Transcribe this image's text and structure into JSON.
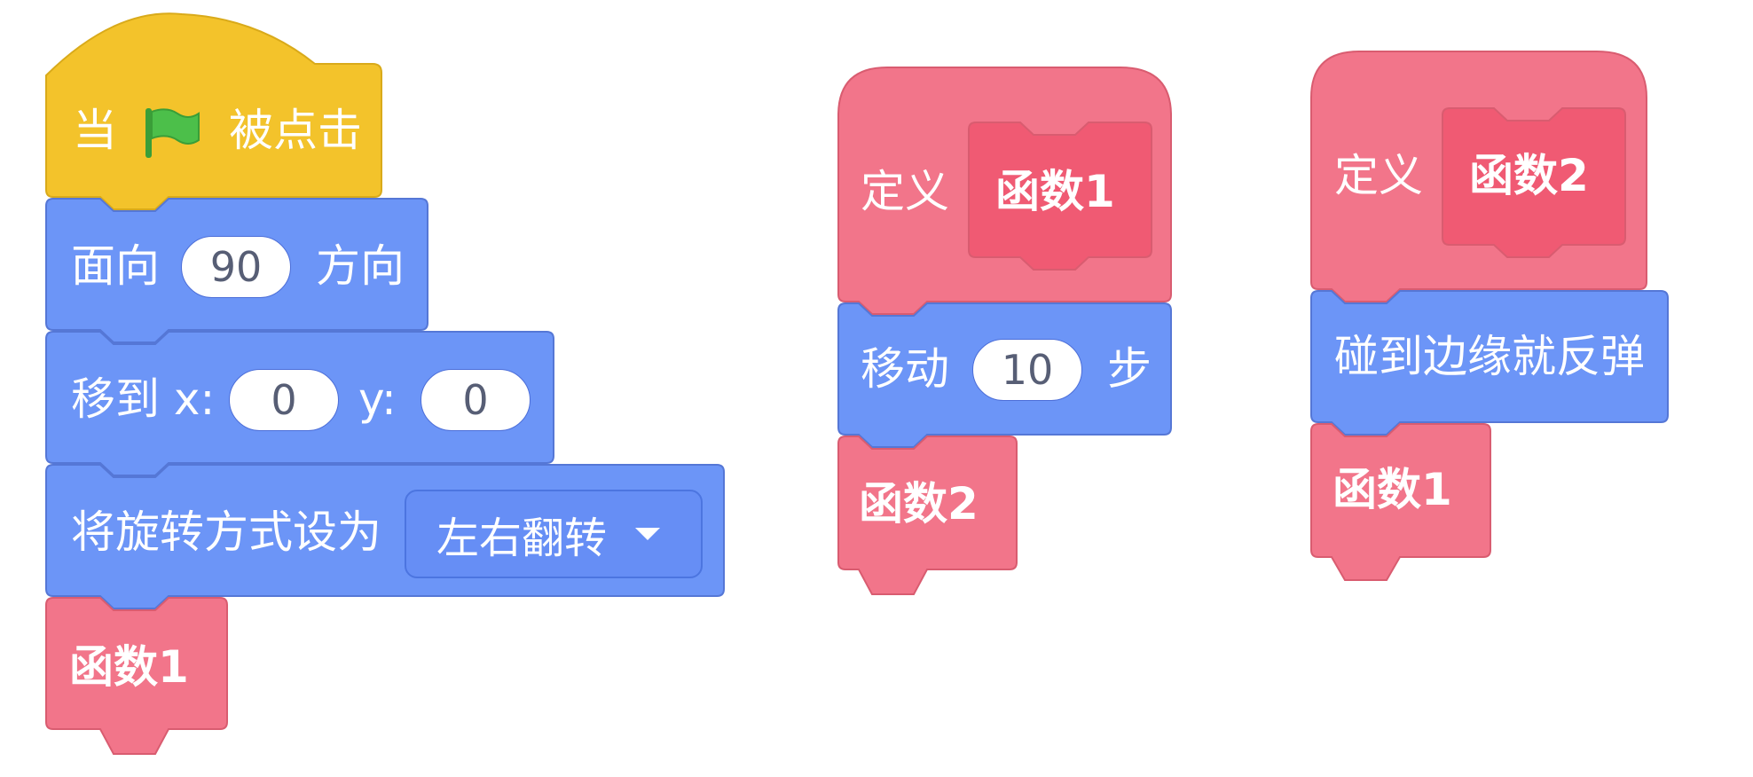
{
  "colors": {
    "events": "#f3c32b",
    "events_edge": "#d9aa1a",
    "motion": "#6c95f7",
    "motion_edge": "#5577d6",
    "custom": "#f2758a",
    "custom_edge": "#d95c70",
    "custom_inner": "#f05a73",
    "flag_green": "#3fb13c"
  },
  "script1": {
    "hat": {
      "before": "当",
      "icon": "green-flag-icon",
      "after": "被点击"
    },
    "point": {
      "label": "面向",
      "value": "90",
      "suffix": "方向"
    },
    "goto": {
      "label": "移到 x:",
      "x_value": "0",
      "y_label": "y:",
      "y_value": "0"
    },
    "rotation": {
      "label": "将旋转方式设为",
      "option": "左右翻转"
    },
    "call": {
      "label": "函数1"
    }
  },
  "script2": {
    "define": {
      "label": "定义",
      "name": "函数1"
    },
    "move": {
      "label": "移动",
      "value": "10",
      "suffix": "步"
    },
    "call": {
      "label": "函数2"
    }
  },
  "script3": {
    "define": {
      "label": "定义",
      "name": "函数2"
    },
    "bounce": {
      "label": "碰到边缘就反弹"
    },
    "call": {
      "label": "函数1"
    }
  }
}
